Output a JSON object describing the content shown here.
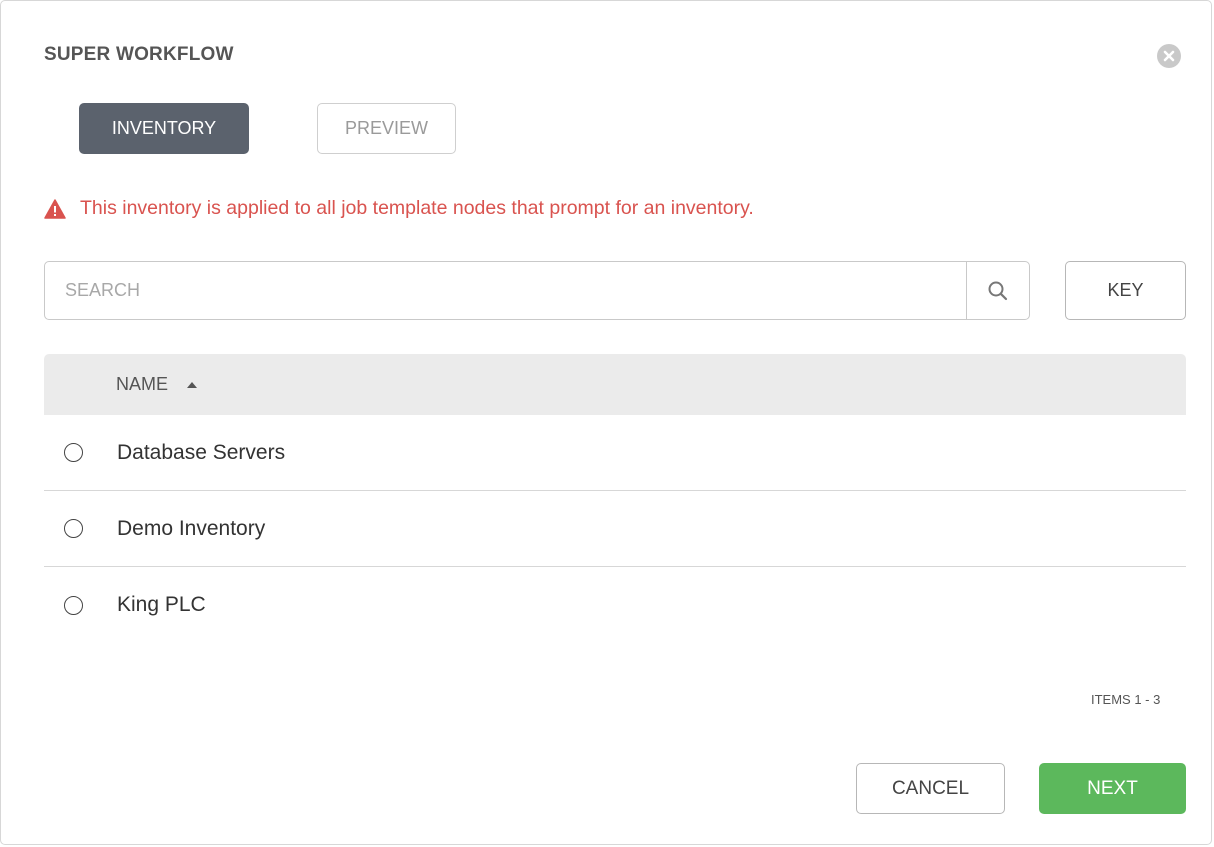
{
  "modal": {
    "title": "SUPER WORKFLOW",
    "close_icon": "close-circle-icon"
  },
  "tabs": [
    {
      "label": "INVENTORY",
      "active": true
    },
    {
      "label": "PREVIEW",
      "active": false
    }
  ],
  "alert": {
    "icon": "warning-triangle-icon",
    "text": "This inventory is applied to all job template nodes that prompt for an inventory.",
    "color": "#d9534f"
  },
  "search": {
    "placeholder": "SEARCH",
    "value": "",
    "icon": "search-icon",
    "key_label": "KEY"
  },
  "table": {
    "column_header": "NAME",
    "sort_icon": "sort-ascending-icon",
    "rows": [
      {
        "name": "Database Servers",
        "selected": false
      },
      {
        "name": "Demo Inventory",
        "selected": false
      },
      {
        "name": "King PLC",
        "selected": false
      }
    ]
  },
  "pagination": {
    "items_text": "ITEMS  1 - 3"
  },
  "footer": {
    "cancel_label": "CANCEL",
    "next_label": "NEXT",
    "next_color": "#5cb85c"
  },
  "colors": {
    "active_tab": "#5b626d",
    "header_bg": "#ebebeb"
  }
}
